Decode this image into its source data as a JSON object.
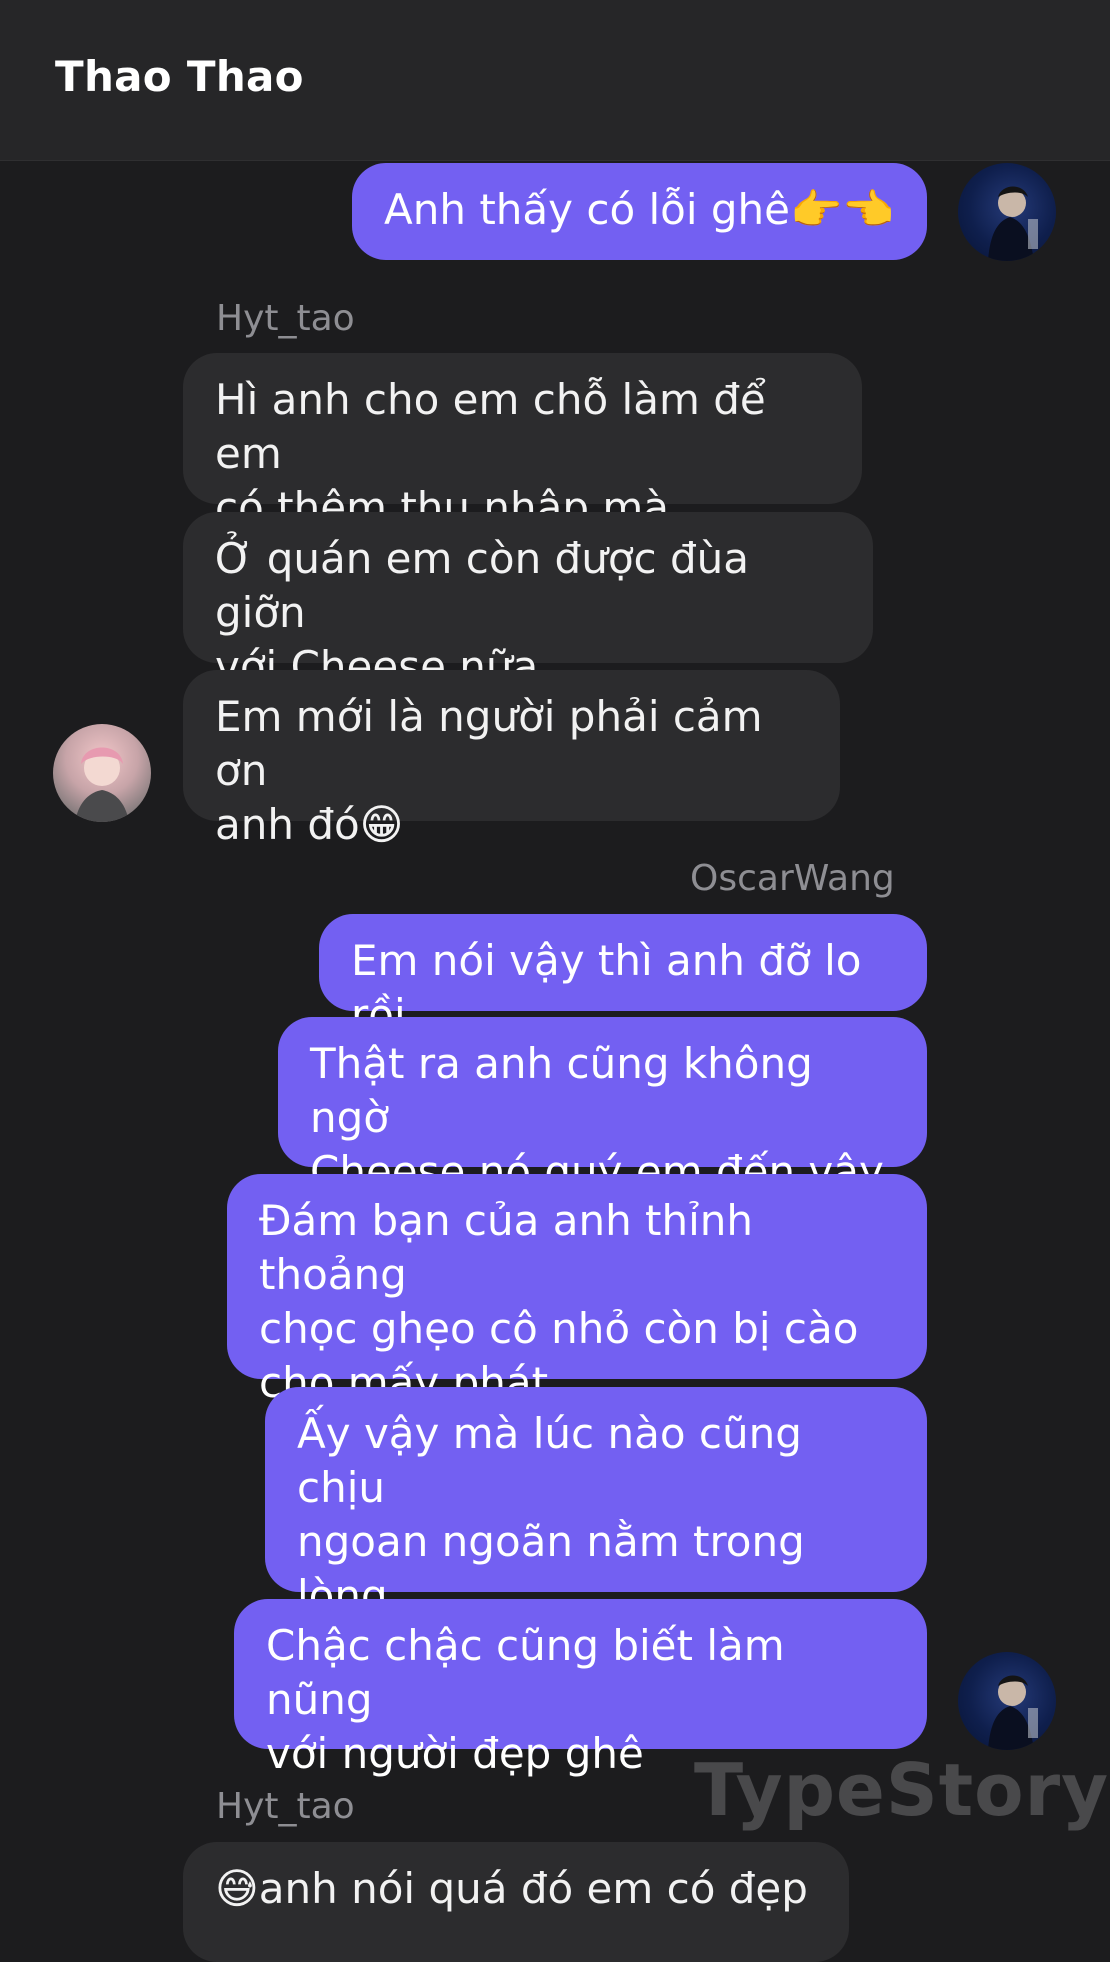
{
  "header": {
    "title": "Thao Thao"
  },
  "senders": {
    "her": "Hyt_tao",
    "me": "OscarWang"
  },
  "messages": {
    "m1": "Anh thấy có lỗi ghê👉👈",
    "m2": "Hì anh cho em chỗ làm để em\ncó thêm thu nhập mà",
    "m3": "Ở quán em còn được đùa giỡn\nvới Cheese nữa",
    "m4": "Em mới là người phải cảm ơn\nanh đó😁",
    "m5": "Em nói vậy thì anh đỡ lo rồi",
    "m6": "Thật ra anh cũng không ngờ\nCheese nó quý em đến vậy",
    "m7": "Đám bạn của anh thỉnh thoảng\nchọc ghẹo cô nhỏ còn bị cào\ncho mấy phát",
    "m8": "Ấy vậy mà lúc nào cũng chịu\nngoan ngoãn nằm trong lòng\nem hết",
    "m9": "Chậc chậc cũng biết làm nũng\nvới người đẹp ghê",
    "m10": "😅anh nói quá đó em có đẹp"
  },
  "watermark": "TypeStory",
  "colors": {
    "outgoing_bubble": "#7360f2",
    "incoming_bubble": "#2c2c2e",
    "background": "#1c1c1e",
    "header": "#262628"
  }
}
